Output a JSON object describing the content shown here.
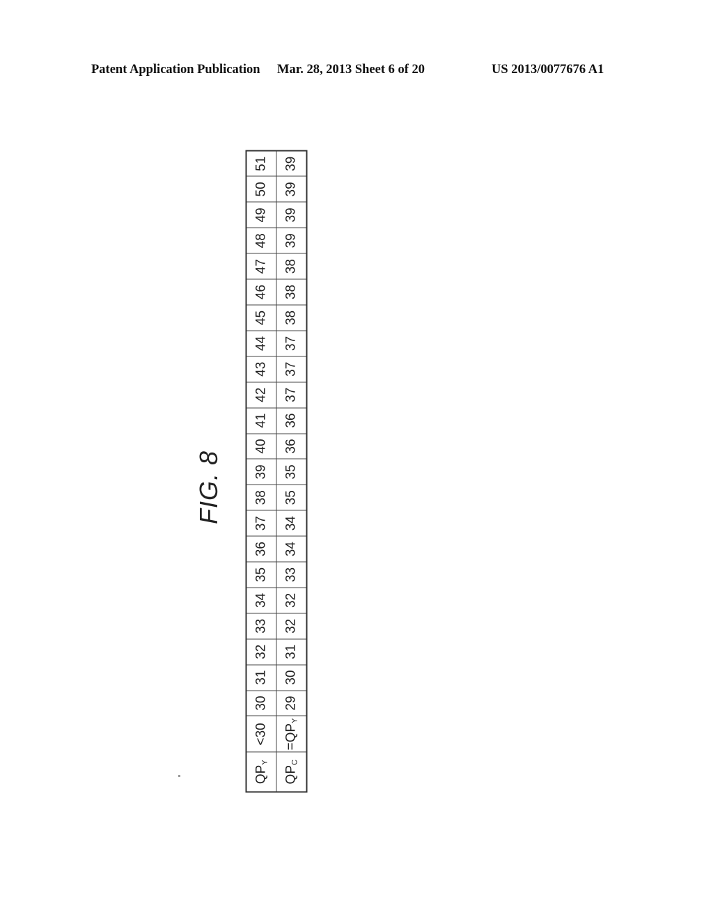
{
  "header": {
    "publication": "Patent Application Publication",
    "date_sheet": "Mar. 28, 2013  Sheet 6 of 20",
    "number": "US 2013/0077676 A1"
  },
  "figure": {
    "label": "FIG. 8"
  },
  "table": {
    "row_headers": [
      {
        "base": "QP",
        "sub": "Y"
      },
      {
        "base": "QP",
        "sub": "C"
      }
    ],
    "qpy_first": "<30",
    "qpc_first_prefix": "=QP",
    "qpc_first_sub": "Y",
    "qpy": [
      "30",
      "31",
      "32",
      "33",
      "34",
      "35",
      "36",
      "37",
      "38",
      "39",
      "40",
      "41",
      "42",
      "43",
      "44",
      "45",
      "46",
      "47",
      "48",
      "49",
      "50",
      "51"
    ],
    "qpc": [
      "29",
      "30",
      "31",
      "32",
      "32",
      "33",
      "34",
      "34",
      "35",
      "35",
      "36",
      "36",
      "37",
      "37",
      "37",
      "38",
      "38",
      "38",
      "39",
      "39",
      "39",
      "39"
    ]
  },
  "chart_data": {
    "type": "table",
    "title": "FIG. 8",
    "columns": [
      "QPY",
      "QPC"
    ],
    "rows": [
      [
        "<30",
        "=QPY"
      ],
      [
        "30",
        "29"
      ],
      [
        "31",
        "30"
      ],
      [
        "32",
        "31"
      ],
      [
        "33",
        "32"
      ],
      [
        "34",
        "32"
      ],
      [
        "35",
        "33"
      ],
      [
        "36",
        "34"
      ],
      [
        "37",
        "34"
      ],
      [
        "38",
        "35"
      ],
      [
        "39",
        "35"
      ],
      [
        "40",
        "36"
      ],
      [
        "41",
        "36"
      ],
      [
        "42",
        "37"
      ],
      [
        "43",
        "37"
      ],
      [
        "44",
        "37"
      ],
      [
        "45",
        "38"
      ],
      [
        "46",
        "38"
      ],
      [
        "47",
        "38"
      ],
      [
        "48",
        "39"
      ],
      [
        "49",
        "39"
      ],
      [
        "50",
        "39"
      ],
      [
        "51",
        "39"
      ]
    ]
  }
}
